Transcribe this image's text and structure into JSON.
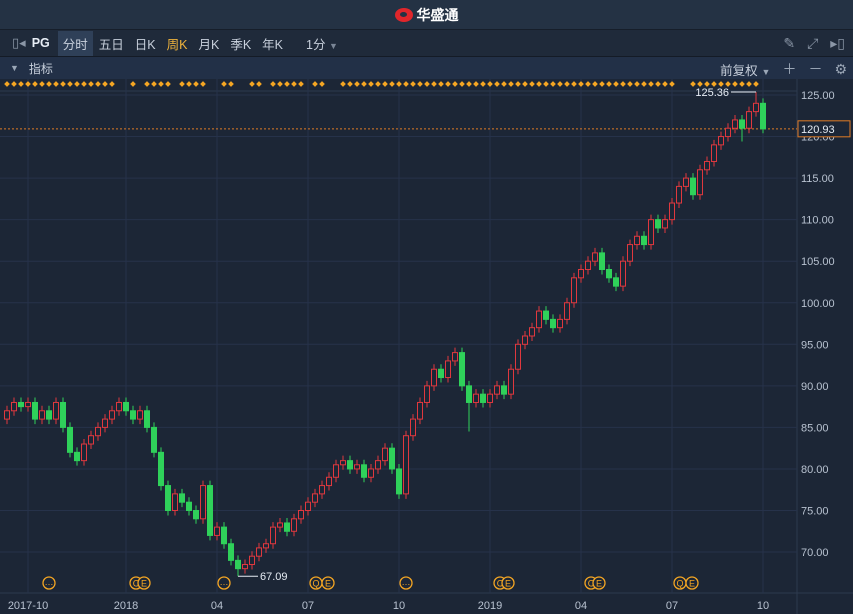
{
  "app": {
    "title": "华盛通",
    "logo": "huasheng-logo"
  },
  "toolbar": {
    "symbol": "PG",
    "tabs": [
      "分时",
      "五日",
      "日K",
      "周K",
      "月K",
      "季K",
      "年K"
    ],
    "active_tab": "周K",
    "interval": "1分",
    "icons": [
      "pencil-icon",
      "fullscreen-icon",
      "collapse-panel-icon"
    ]
  },
  "indicator_bar": {
    "label": "指标",
    "adjust": "前复权",
    "icons": [
      "plus-icon",
      "minus-icon",
      "gear-icon"
    ]
  },
  "colors": {
    "up": "#e0383e",
    "down": "#2fd15a",
    "marker": "#f5a623",
    "last_price": "#e07b25"
  },
  "chart_data": {
    "type": "candlestick",
    "symbol": "PG",
    "period": "weekly",
    "ylim": [
      66,
      126
    ],
    "yticks": [
      "70.00",
      "75.00",
      "80.00",
      "85.00",
      "90.00",
      "95.00",
      "100.00",
      "105.00",
      "110.00",
      "115.00",
      "120.00",
      "125.00"
    ],
    "xticks": [
      {
        "label": "2017-10",
        "week": 3
      },
      {
        "label": "2018",
        "week": 17
      },
      {
        "label": "04",
        "week": 30
      },
      {
        "label": "07",
        "week": 43
      },
      {
        "label": "10",
        "week": 56
      },
      {
        "label": "2019",
        "week": 69
      },
      {
        "label": "04",
        "week": 82
      },
      {
        "label": "07",
        "week": 95
      },
      {
        "label": "10",
        "week": 108
      }
    ],
    "last_price": "120.93",
    "max_label": "125.36",
    "min_label": "67.09",
    "events": [
      {
        "week": 6,
        "type": "more"
      },
      {
        "week": 19,
        "type": "CE"
      },
      {
        "week": 31,
        "type": "more"
      },
      {
        "week": 45,
        "type": "QE"
      },
      {
        "week": 57,
        "type": "more"
      },
      {
        "week": 71,
        "type": "CE"
      },
      {
        "week": 84,
        "type": "CE"
      },
      {
        "week": 97,
        "type": "QE"
      }
    ],
    "event_glyphs": {
      "more": "…",
      "CE": "C",
      "QE": "Q",
      "E": "E"
    },
    "marker_weeks": [
      0,
      1,
      2,
      3,
      4,
      5,
      6,
      7,
      8,
      9,
      10,
      11,
      12,
      13,
      14,
      15,
      18,
      20,
      21,
      22,
      23,
      25,
      26,
      27,
      28,
      31,
      32,
      35,
      36,
      38,
      39,
      40,
      41,
      42,
      44,
      45,
      48,
      49,
      50,
      51,
      52,
      53,
      54,
      55,
      56,
      57,
      58,
      59,
      60,
      61,
      62,
      63,
      64,
      65,
      66,
      67,
      68,
      69,
      70,
      71,
      72,
      73,
      74,
      75,
      76,
      77,
      78,
      79,
      80,
      81,
      82,
      83,
      84,
      85,
      86,
      87,
      88,
      89,
      90,
      91,
      92,
      93,
      94,
      95,
      98,
      99,
      100,
      101,
      102,
      103,
      104,
      105,
      106,
      107
    ],
    "candles": [
      [
        86,
        87.6,
        85.4,
        87
      ],
      [
        87,
        88.6,
        86.4,
        88
      ],
      [
        88,
        88.6,
        86.9,
        87.5
      ],
      [
        87.5,
        88.6,
        86.9,
        88
      ],
      [
        88,
        88.6,
        85.4,
        86
      ],
      [
        86,
        87.6,
        85.4,
        87
      ],
      [
        87,
        87.6,
        85.4,
        86
      ],
      [
        86,
        88.6,
        85.4,
        88
      ],
      [
        88,
        88.6,
        84.4,
        85
      ],
      [
        85,
        85.6,
        81.4,
        82
      ],
      [
        82,
        82.6,
        80.4,
        81
      ],
      [
        81,
        83.6,
        80.4,
        83
      ],
      [
        83,
        84.6,
        82.4,
        84
      ],
      [
        84,
        85.6,
        83.4,
        85
      ],
      [
        85,
        86.6,
        84.4,
        86
      ],
      [
        86,
        87.6,
        85.4,
        87
      ],
      [
        87,
        88.6,
        86.4,
        88
      ],
      [
        88,
        88.6,
        86.4,
        87
      ],
      [
        87,
        87.6,
        85.4,
        86
      ],
      [
        86,
        87.6,
        85.4,
        87
      ],
      [
        87,
        87.6,
        84.4,
        85
      ],
      [
        85,
        85.6,
        81.4,
        82
      ],
      [
        82,
        82.6,
        77.4,
        78
      ],
      [
        78,
        78.6,
        74.4,
        75
      ],
      [
        75,
        77.6,
        74.4,
        77
      ],
      [
        77,
        77.6,
        75.4,
        76
      ],
      [
        76,
        76.6,
        74.4,
        75
      ],
      [
        75,
        75.6,
        73.4,
        74
      ],
      [
        74,
        78.6,
        73.4,
        78
      ],
      [
        78,
        78.6,
        71.4,
        72
      ],
      [
        72,
        73.6,
        71.4,
        73
      ],
      [
        73,
        73.6,
        70.4,
        71
      ],
      [
        71,
        71.6,
        68.4,
        69
      ],
      [
        69,
        69.6,
        67.09,
        68
      ],
      [
        68,
        69.1,
        67.4,
        68.5
      ],
      [
        68.5,
        70.1,
        67.9,
        69.5
      ],
      [
        69.5,
        71.1,
        68.9,
        70.5
      ],
      [
        70.5,
        71.6,
        69.9,
        71
      ],
      [
        71,
        73.6,
        70.4,
        73
      ],
      [
        73,
        74.1,
        72.4,
        73.5
      ],
      [
        73.5,
        74.1,
        71.9,
        72.5
      ],
      [
        72.5,
        74.6,
        71.9,
        74
      ],
      [
        74,
        75.6,
        73.4,
        75
      ],
      [
        75,
        76.6,
        74.4,
        76
      ],
      [
        76,
        77.6,
        75.4,
        77
      ],
      [
        77,
        78.6,
        76.4,
        78
      ],
      [
        78,
        79.6,
        77.4,
        79
      ],
      [
        79,
        81.1,
        78.4,
        80.5
      ],
      [
        80.5,
        81.6,
        79.9,
        81
      ],
      [
        81,
        81.6,
        79.4,
        80
      ],
      [
        80,
        81.1,
        79.4,
        80.5
      ],
      [
        80.5,
        81.1,
        78.4,
        79
      ],
      [
        79,
        80.6,
        78.4,
        80
      ],
      [
        80,
        81.6,
        79.4,
        81
      ],
      [
        81,
        83.1,
        80.4,
        82.5
      ],
      [
        82.5,
        83.1,
        79.4,
        80
      ],
      [
        80,
        80.6,
        76.4,
        77
      ],
      [
        77,
        84.6,
        76.4,
        84
      ],
      [
        84,
        86.6,
        83.4,
        86
      ],
      [
        86,
        88.6,
        85.4,
        88
      ],
      [
        88,
        90.6,
        87.4,
        90
      ],
      [
        90,
        92.6,
        89.4,
        92
      ],
      [
        92,
        92.6,
        90.4,
        91
      ],
      [
        91,
        93.6,
        90.4,
        93
      ],
      [
        93,
        94.6,
        92.4,
        94
      ],
      [
        94,
        94.6,
        89.4,
        90
      ],
      [
        90,
        90.6,
        84.5,
        88
      ],
      [
        88,
        89.6,
        87.4,
        89
      ],
      [
        89,
        89.6,
        87.4,
        88
      ],
      [
        88,
        89.6,
        87.4,
        89
      ],
      [
        89,
        90.6,
        88.4,
        90
      ],
      [
        90,
        90.6,
        88.4,
        89
      ],
      [
        89,
        92.6,
        88.4,
        92
      ],
      [
        92,
        95.6,
        91.4,
        95
      ],
      [
        95,
        96.6,
        94.4,
        96
      ],
      [
        96,
        97.6,
        95.4,
        97
      ],
      [
        97,
        99.6,
        96.4,
        99
      ],
      [
        99,
        99.6,
        97.4,
        98
      ],
      [
        98,
        98.6,
        96.4,
        97
      ],
      [
        97,
        98.6,
        96.4,
        98
      ],
      [
        98,
        100.6,
        97.4,
        100
      ],
      [
        100,
        103.6,
        99.4,
        103
      ],
      [
        103,
        104.6,
        102.4,
        104
      ],
      [
        104,
        105.6,
        103.4,
        105
      ],
      [
        105,
        106.6,
        104.4,
        106
      ],
      [
        106,
        106.6,
        103.4,
        104
      ],
      [
        104,
        104.6,
        102.4,
        103
      ],
      [
        103,
        103.6,
        101.4,
        102
      ],
      [
        102,
        105.6,
        101.4,
        105
      ],
      [
        105,
        107.6,
        104.4,
        107
      ],
      [
        107,
        108.6,
        106.4,
        108
      ],
      [
        108,
        108.6,
        106.4,
        107
      ],
      [
        107,
        110.6,
        106.4,
        110
      ],
      [
        110,
        110.6,
        108.4,
        109
      ],
      [
        109,
        110.6,
        108.4,
        110
      ],
      [
        110,
        112.6,
        109.4,
        112
      ],
      [
        112,
        114.6,
        111.4,
        114
      ],
      [
        114,
        115.6,
        113.4,
        115
      ],
      [
        115,
        115.6,
        112.4,
        113
      ],
      [
        113,
        116.6,
        112.4,
        116
      ],
      [
        116,
        117.6,
        115.4,
        117
      ],
      [
        117,
        119.6,
        116.4,
        119
      ],
      [
        119,
        120.6,
        118.4,
        120
      ],
      [
        120,
        121.6,
        119.4,
        121
      ],
      [
        121,
        122.6,
        120.4,
        122
      ],
      [
        122,
        122.6,
        119.4,
        121
      ],
      [
        121,
        123.6,
        120.4,
        123
      ],
      [
        123,
        125.36,
        122.4,
        124
      ],
      [
        124,
        124.6,
        120.4,
        120.93
      ]
    ]
  }
}
